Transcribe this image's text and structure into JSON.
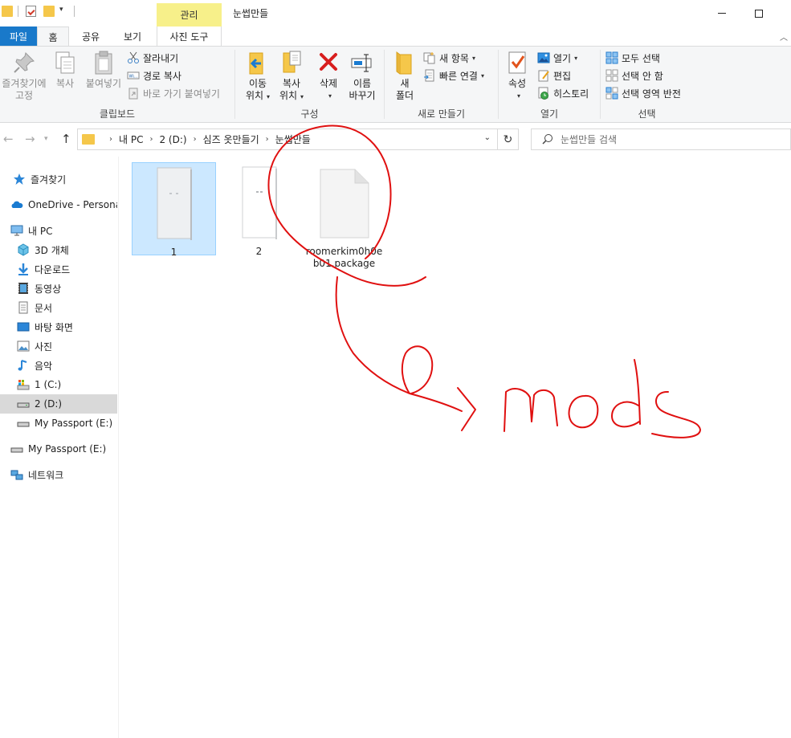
{
  "titlebar": {
    "context_tab": "관리",
    "window_title": "눈썹만들"
  },
  "ribbon_tabs": {
    "file": "파일",
    "home": "홈",
    "share": "공유",
    "view": "보기",
    "picture_tools": "사진 도구"
  },
  "clipboard": {
    "pin": "즐겨찾기에 고정",
    "pin_line1": "즐겨찾기에",
    "pin_line2": "고정",
    "copy": "복사",
    "paste": "붙여넣기",
    "cut": "잘라내기",
    "copy_path": "경로 복사",
    "paste_shortcut": "바로 가기 붙여넣기",
    "label": "클립보드"
  },
  "organize": {
    "move_to_line1": "이동",
    "move_to_line2": "위치",
    "copy_to_line1": "복사",
    "copy_to_line2": "위치",
    "delete": "삭제",
    "rename_line1": "이름",
    "rename_line2": "바꾸기",
    "label": "구성"
  },
  "new": {
    "new_folder_line1": "새",
    "new_folder_line2": "폴더",
    "new_item": "새 항목",
    "easy_access": "빠른 연결",
    "label": "새로 만들기"
  },
  "open": {
    "properties": "속성",
    "open": "열기",
    "edit": "편집",
    "history": "히스토리",
    "label": "열기"
  },
  "select": {
    "select_all": "모두 선택",
    "select_none": "선택 안 함",
    "invert": "선택 영역 반전",
    "label": "선택"
  },
  "address": {
    "crumbs": [
      "내 PC",
      "2 (D:)",
      "심즈 옷만들기",
      "눈썹만들"
    ],
    "search_placeholder": "눈썹만들 검색"
  },
  "navpane": {
    "quick_access": "즐겨찾기",
    "onedrive": "OneDrive - Personal",
    "this_pc": "내 PC",
    "objects3d": "3D 개체",
    "downloads": "다운로드",
    "videos": "동영상",
    "documents": "문서",
    "desktop": "바탕 화면",
    "pictures": "사진",
    "music": "음악",
    "drive_c": "1 (C:)",
    "drive_d": "2 (D:)",
    "passport_sub": "My Passport (E:)",
    "passport": "My Passport (E:)",
    "network": "네트워크"
  },
  "files": [
    {
      "name": "1",
      "selected": true
    },
    {
      "name": "2",
      "selected": false
    },
    {
      "name": "roomerkim0h0eb01.package",
      "selected": false
    }
  ],
  "annotation": {
    "text": "mods",
    "color": "#e01010"
  },
  "colors": {
    "accent": "#1979ca",
    "selection": "#cce8ff",
    "context_tab": "#f7f08a"
  }
}
